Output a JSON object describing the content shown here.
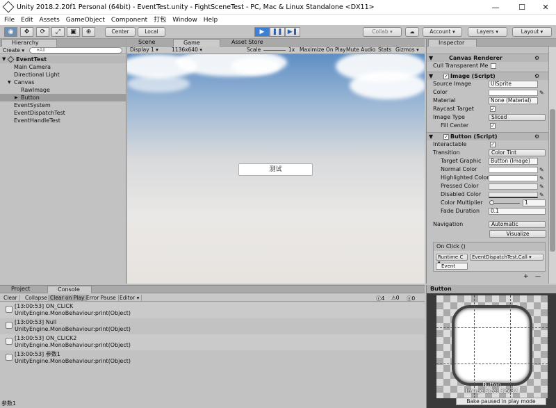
{
  "window": {
    "title": "Unity 2018.2.20f1 Personal (64bit) - EventTest.unity - FightSceneTest - PC, Mac & Linux Standalone <DX11>",
    "min": "—",
    "max": "☐",
    "close": "✕"
  },
  "menu": [
    "File",
    "Edit",
    "Assets",
    "GameObject",
    "Component",
    "打包",
    "Window",
    "Help"
  ],
  "toolbar": {
    "center": "Center",
    "local": "Local",
    "collab": "Collab ▾",
    "account": "Account ▾",
    "layers": "Layers ▾",
    "layout": "Layout ▾",
    "cloud": "☁"
  },
  "hierarchy": {
    "tab": "Hierarchy",
    "create": "Create ▾",
    "search_placeholder": "▾All",
    "scene": "EventTest",
    "items": [
      {
        "label": "Main Camera",
        "indent": 1
      },
      {
        "label": "Directional Light",
        "indent": 1
      },
      {
        "label": "Canvas",
        "indent": 1,
        "arrow": "▼"
      },
      {
        "label": "RawImage",
        "indent": 2
      },
      {
        "label": "Button",
        "indent": 2,
        "arrow": "▶",
        "selected": true
      },
      {
        "label": "EventSystem",
        "indent": 1
      },
      {
        "label": "EventDispatchTest",
        "indent": 1
      },
      {
        "label": "EventHandleTest",
        "indent": 1
      }
    ]
  },
  "tabs": {
    "scene": "Scene",
    "game": "Game",
    "asset_store": "Asset Store"
  },
  "gamebar": {
    "display": "Display 1 ▾",
    "resolution": "1136x640 ▾",
    "scale_label": "Scale",
    "scale_value": "1x",
    "maximize": "Maximize On Play",
    "mute": "Mute Audio",
    "stats": "Stats",
    "gizmos": "Gizmos ▾"
  },
  "game": {
    "button_text": "测试"
  },
  "console": {
    "tab_project": "Project",
    "tab_console": "Console",
    "buttons": [
      "Clear",
      "Collapse",
      "Clear on Play",
      "Error Pause",
      "Editor ▾"
    ],
    "counts": {
      "log": "4",
      "warn": "0",
      "err": "0"
    },
    "entries": [
      {
        "line1": "[13:00:53] ON_CLICK",
        "line2": "UnityEngine.MonoBehaviour:print(Object)"
      },
      {
        "line1": "[13:00:53] Null",
        "line2": "UnityEngine.MonoBehaviour:print(Object)"
      },
      {
        "line1": "[13:00:53] ON_CLICK2",
        "line2": "UnityEngine.MonoBehaviour:print(Object)"
      },
      {
        "line1": "[13:00:53] 参数1",
        "line2": "UnityEngine.MonoBehaviour:print(Object)"
      }
    ]
  },
  "inspector": {
    "tab": "Inspector",
    "canvas_renderer": "Canvas Renderer",
    "cull": "Cull Transparent Me",
    "image_title": "Image (Script)",
    "source_image": {
      "label": "Source Image",
      "value": "UISprite"
    },
    "color": {
      "label": "Color"
    },
    "material": {
      "label": "Material",
      "value": "None (Material)"
    },
    "raycast": {
      "label": "Raycast Target"
    },
    "image_type": {
      "label": "Image Type",
      "value": "Sliced"
    },
    "fill_center": {
      "label": "Fill Center"
    },
    "button_title": "Button (Script)",
    "interactable": {
      "label": "Interactable"
    },
    "transition": {
      "label": "Transition",
      "value": "Color Tint"
    },
    "target_graphic": {
      "label": "Target Graphic",
      "value": "Button (Image)"
    },
    "normal": {
      "label": "Normal Color"
    },
    "highlighted": {
      "label": "Highlighted Color"
    },
    "pressed": {
      "label": "Pressed Color"
    },
    "disabled": {
      "label": "Disabled Color"
    },
    "multiplier": {
      "label": "Color Multiplier",
      "value": "1"
    },
    "fade": {
      "label": "Fade Duration",
      "value": "0.1"
    },
    "navigation": {
      "label": "Navigation",
      "value": "Automatic"
    },
    "visualize": "Visualize",
    "onclick": "On Click ()",
    "runtime": "Runtime C ▾",
    "method": "EventDispatchTest.Call ▾",
    "event": "Event",
    "plus": "+",
    "minus": "—"
  },
  "preview": {
    "tab": "Button",
    "name": "Button",
    "size": "Image Size: 32x32"
  },
  "status": {
    "left": "参数1",
    "right": "Bake paused in play mode"
  }
}
